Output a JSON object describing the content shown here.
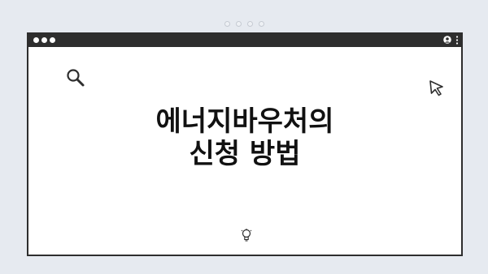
{
  "slide": {
    "title_line1": "에너지바우처의",
    "title_line2": "신청 방법"
  },
  "icons": {
    "search": "search-icon",
    "cursor": "cursor-icon",
    "user": "user-icon",
    "menu": "kebab-menu-icon",
    "bulb": "lightbulb-icon"
  },
  "colors": {
    "background": "#e6eaf0",
    "window_frame": "#2e2e2e",
    "window_body": "#ffffff",
    "text": "#111111"
  }
}
